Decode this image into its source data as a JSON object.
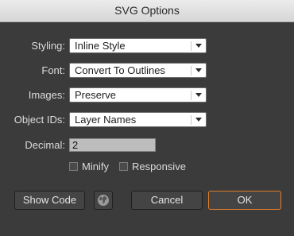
{
  "window": {
    "title": "SVG Options"
  },
  "form": {
    "styling": {
      "label": "Styling:",
      "value": "Inline Style"
    },
    "font": {
      "label": "Font:",
      "value": "Convert To Outlines"
    },
    "images": {
      "label": "Images:",
      "value": "Preserve"
    },
    "object_ids": {
      "label": "Object IDs:",
      "value": "Layer Names"
    },
    "decimal": {
      "label": "Decimal:",
      "value": "2"
    },
    "minify": {
      "label": "Minify",
      "checked": false
    },
    "responsive": {
      "label": "Responsive",
      "checked": false
    }
  },
  "buttons": {
    "show_code": "Show Code",
    "globe_icon": "globe-icon",
    "cancel": "Cancel",
    "ok": "OK"
  },
  "colors": {
    "background": "#3b3b3b",
    "accent_border": "#e07d2c"
  }
}
